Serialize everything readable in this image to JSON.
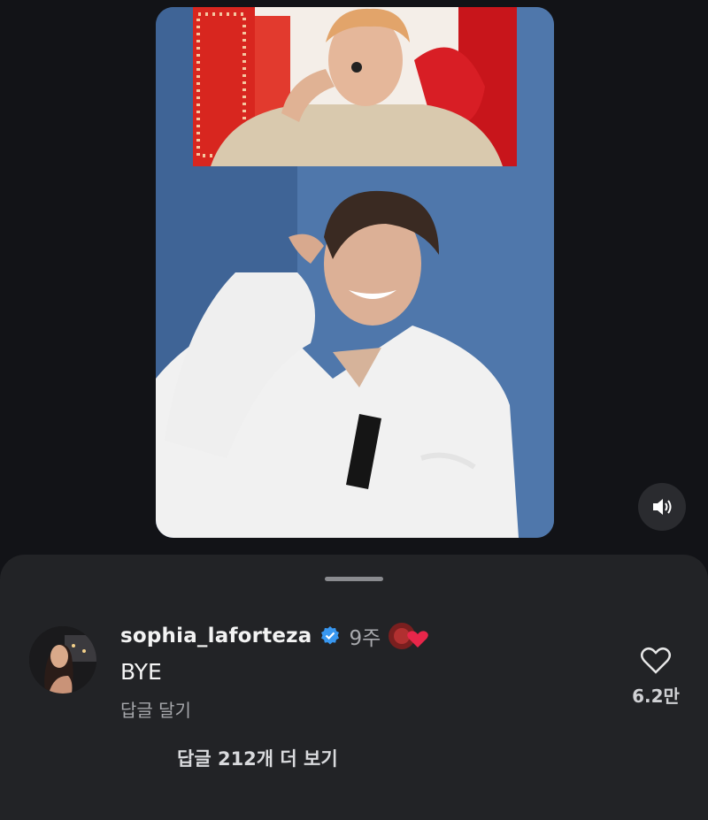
{
  "video": {
    "inset_clip": {
      "description_icon": "stage-performer-clip"
    },
    "main": {
      "description_icon": "creator-video"
    },
    "sound_button": {
      "icon": "speaker-icon"
    }
  },
  "comment_sheet": {
    "comment": {
      "username": "sophia_laforteza",
      "verified": true,
      "time": "9주",
      "text": "BYE",
      "reply_label": "답글 달기",
      "like_count": "6.2만"
    },
    "more_replies_label": "답글 212개 더 보기"
  },
  "colors": {
    "background": "#121317",
    "sheet": "#222326",
    "verified_badge": "#3897f0",
    "heart_reaction": "#e8264a"
  }
}
